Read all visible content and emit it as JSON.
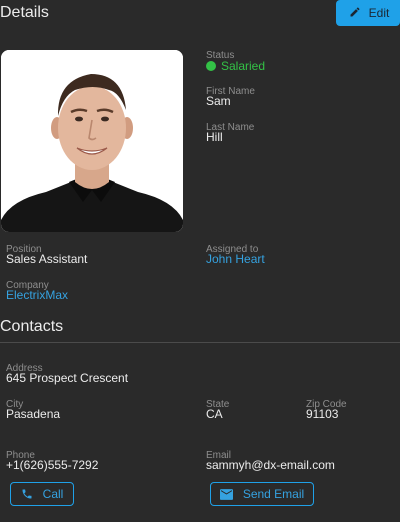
{
  "details": {
    "title": "Details",
    "edit_label": "Edit",
    "photo_alt": "Employee photo",
    "status": {
      "label": "Status",
      "value": "Salaried",
      "color": "#33c146"
    },
    "first_name": {
      "label": "First Name",
      "value": "Sam"
    },
    "last_name": {
      "label": "Last Name",
      "value": "Hill"
    },
    "position": {
      "label": "Position",
      "value": "Sales Assistant"
    },
    "assigned_to": {
      "label": "Assigned to",
      "value": "John Heart"
    },
    "company": {
      "label": "Company",
      "value": "ElectrixMax"
    }
  },
  "contacts": {
    "title": "Contacts",
    "address": {
      "label": "Address",
      "value": "645 Prospect Crescent"
    },
    "city": {
      "label": "City",
      "value": "Pasadena"
    },
    "state": {
      "label": "State",
      "value": "CA"
    },
    "zip": {
      "label": "Zip Code",
      "value": "91103"
    },
    "phone": {
      "label": "Phone",
      "value": "+1(626)555-7292"
    },
    "email": {
      "label": "Email",
      "value": "sammyh@dx-email.com"
    },
    "call_label": "Call",
    "send_email_label": "Send Email"
  },
  "colors": {
    "accent": "#1fa1e8",
    "link": "#35a2e0",
    "background": "#2a2a2a",
    "status_green": "#33c146"
  }
}
